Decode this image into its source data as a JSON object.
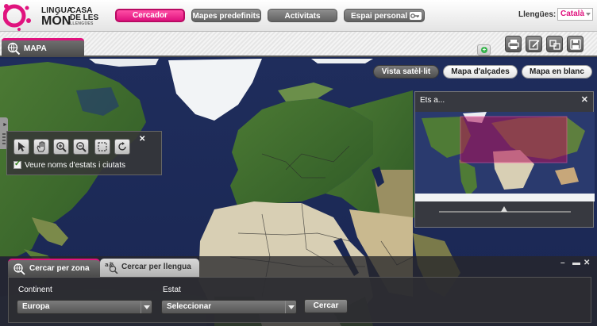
{
  "logo": {
    "line1": "LINGUA",
    "line2": "MÓN",
    "line3": "CASA",
    "line4": "DE LES",
    "line5": "LLENGÜES"
  },
  "nav": {
    "items": [
      {
        "label": "Cercador",
        "active": true
      },
      {
        "label": "Mapes predefinits",
        "active": false
      },
      {
        "label": "Activitats",
        "active": false
      },
      {
        "label": "Espai personal",
        "active": false
      }
    ]
  },
  "language": {
    "label": "Llengües:",
    "selected": "Català"
  },
  "tabs": {
    "map_tab": "MAPA"
  },
  "view_buttons": {
    "satellite": "Vista satèl·lit",
    "relief": "Mapa d'alçades",
    "blank": "Mapa en blanc"
  },
  "overview": {
    "title": "Ets a...",
    "close": "✕"
  },
  "palette": {
    "checkbox_label": "Veure noms d'estats i ciutats",
    "checked": true,
    "close": "✕"
  },
  "search_panel": {
    "tab_zone": "Cercar per zona",
    "tab_language": "Cercar per llengua",
    "continent_label": "Continent",
    "continent_value": "Europa",
    "state_label": "Estat",
    "state_value": "Seleccionar",
    "search_button": "Cercar",
    "minimize": "–",
    "maximize": "▬",
    "close": "✕"
  },
  "colors": {
    "accent": "#e0137e",
    "ocean": "#1c2a56",
    "land": "#3e6a2c",
    "desert": "#d8cfb4",
    "ice": "#f2f4f6"
  }
}
